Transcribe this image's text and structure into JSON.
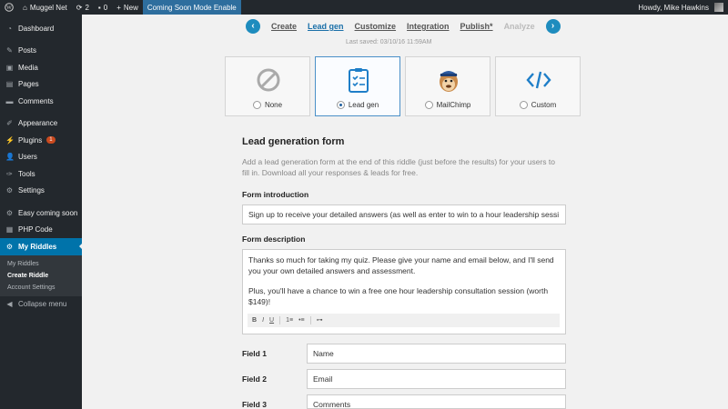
{
  "adminbar": {
    "site_name": "Muggel Net",
    "updates_count": "2",
    "comments_count": "0",
    "new_label": "New",
    "coming_soon": "Coming Soon Mode Enable",
    "howdy": "Howdy, Mike Hawkins"
  },
  "sidebar": {
    "dashboard": "Dashboard",
    "posts": "Posts",
    "media": "Media",
    "pages": "Pages",
    "comments": "Comments",
    "appearance": "Appearance",
    "plugins": "Plugins",
    "plugins_badge": "1",
    "users": "Users",
    "tools": "Tools",
    "settings": "Settings",
    "easy_coming_soon": "Easy coming soon",
    "php_code": "PHP Code",
    "my_riddles": "My Riddles",
    "sub_my_riddles": "My Riddles",
    "sub_create_riddle": "Create Riddle",
    "sub_account_settings": "Account Settings",
    "collapse": "Collapse menu"
  },
  "steps": {
    "create": "Create",
    "lead_gen": "Lead gen",
    "customize": "Customize",
    "integration": "Integration",
    "publish": "Publish*",
    "analyze": "Analyze",
    "last_saved": "Last saved: 03/10/16 11:59AM"
  },
  "cards": {
    "none": "None",
    "lead_gen": "Lead gen",
    "mailchimp": "MailChimp",
    "custom": "Custom",
    "selected": "Lead gen"
  },
  "form": {
    "title": "Lead generation form",
    "description": "Add a lead generation form at the end of this riddle (just before the results) for your users to fill in. Download all your responses & leads for free.",
    "intro_label": "Form introduction",
    "intro_value": "Sign up to receive your detailed answers (as well as enter to win to a hour leadership sessi",
    "desc_label": "Form description",
    "desc_para1": "Thanks so much for taking my quiz. Please give your name and email below, and I'll send you your own detailed answers and assessment.",
    "desc_para2": "Plus, you'll have a chance to win a free one hour leadership consultation session (worth $149)!",
    "fields": [
      {
        "label": "Field 1",
        "value": "Name"
      },
      {
        "label": "Field 2",
        "value": "Email"
      },
      {
        "label": "Field 3",
        "value": "Comments"
      }
    ]
  },
  "toolbar": {
    "bold": "B",
    "italic": "I",
    "underline": "U",
    "ordered_list": "1≡",
    "bullet_list": "•≡",
    "link": "🔗"
  },
  "colors": {
    "accent": "#0073aa",
    "adminbar": "#23282d",
    "highlight": "#2e6e9e"
  }
}
